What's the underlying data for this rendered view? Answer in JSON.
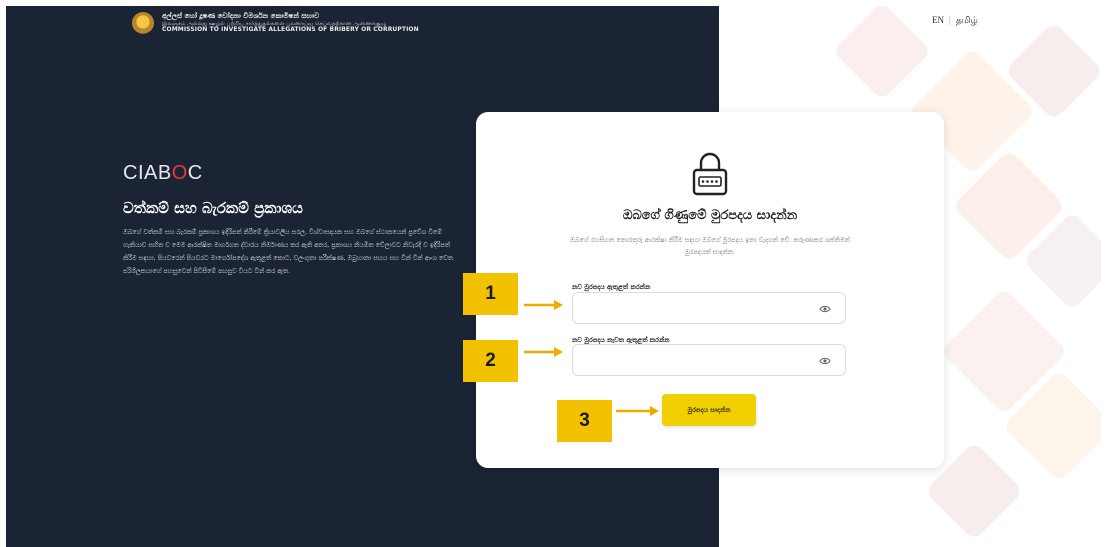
{
  "header": {
    "org_name_si": "අල්ලස් හෝ දූෂණ චෝදනා විමර්ශන කොමිෂන් සභාව",
    "org_name_ta": "இலஞ்சம் அல்லது ஊழல் பற்றிய சார்த்துதல்களை புலனாய்வு செய்வதற்கான ஆணைக்குழு",
    "org_name_en": "COMMISSION TO INVESTIGATE ALLEGATIONS OF BRIBERY OR CORRUPTION",
    "emblem_icon": "sri-lanka-emblem-icon"
  },
  "language": {
    "en": "EN",
    "separator": "|",
    "ta": "தமிழ்"
  },
  "brand": {
    "prefix": "CIAB",
    "dot": "O",
    "suffix": "C",
    "dot_color": "#e23b3b"
  },
  "left": {
    "title": "වත්කම් සහ බැරකම් ප්‍රකාශය",
    "description": "ඔබගේ වත්කම් සහ බැරකම් ප්‍රකාශය ඉදිරිපත් කිරීමේ ක්‍රියාවලිය සරල, විශ්වාසදායක සහ ඔබගේ ස්ථානයෙන් ප්‍රවේශ වීමේ හැකියාව සහිත ව මෙම ආරක්ෂිත මාර්ගගත ද්වාරය නිර්මාණය කර ඇති අතර, ප්‍රකාශය නියමිත වේලාවට නිවැරදි ව ඉදිරිපත් කිරීම සඳහා, පියවරෙන් පියවරට මාර්ගෝපදේශ ඇතුළත් කොට, වලංගුතා පරීක්ෂණ, ඔබුහානා සහය සහ වින් වින් ආංශ වෙත පරිශීලකයාගේ පහසුවෙන් පිවිසීමේ පහසුව වියට වින් කර ඇත."
  },
  "card": {
    "lock_icon": "password-lock-icon",
    "title": "ඔබගේ ගිණුමේ මුරපදය සාදන්න",
    "subtitle": "ඔබගේ රහසිගත තොරතුරු ආරක්ෂා කිරීම සඳහා ඔබගේ මුරපදය ඉතා වැදගත් වේ. කරුණාකර ශක්තිමත් මුරපදයක් සාදන්න.",
    "new_password_label": "නව මුරපදය ඇතුළත් කරන්න",
    "new_password_value": "",
    "confirm_password_label": "නව මුරපදය නැවත ඇතුළත් කරන්න",
    "confirm_password_value": "",
    "eye_icon": "show-password-eye-icon",
    "submit_label": "මුරපදය සාදන්න",
    "accent_color": "#f1d000"
  },
  "annotations": [
    {
      "label": "1"
    },
    {
      "label": "2"
    },
    {
      "label": "3"
    }
  ]
}
